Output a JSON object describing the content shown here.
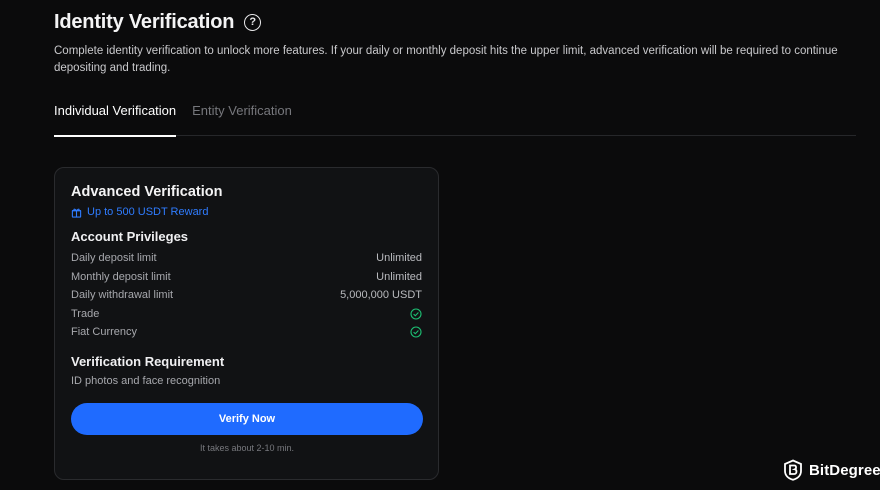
{
  "header": {
    "title": "Identity Verification",
    "subtitle": "Complete identity verification to unlock more features. If your daily or monthly deposit hits the upper limit, advanced verification will be required to continue depositing and trading."
  },
  "tabs": [
    {
      "label": "Individual Verification",
      "active": true
    },
    {
      "label": "Entity Verification",
      "active": false
    }
  ],
  "card": {
    "title": "Advanced Verification",
    "reward": "Up to 500 USDT Reward",
    "privileges_title": "Account Privileges",
    "privileges": [
      {
        "label": "Daily deposit limit",
        "value": "Unlimited"
      },
      {
        "label": "Monthly deposit limit",
        "value": "Unlimited"
      },
      {
        "label": "Daily withdrawal limit",
        "value": "5,000,000 USDT"
      },
      {
        "label": "Trade",
        "value": "check"
      },
      {
        "label": "Fiat Currency",
        "value": "check"
      }
    ],
    "requirement_title": "Verification Requirement",
    "requirement_text": "ID photos and face recognition",
    "button_label": "Verify Now",
    "hint": "It takes about 2-10 min."
  },
  "brand": {
    "name": "BitDegree"
  },
  "colors": {
    "accent": "#1f6bff",
    "reward": "#2f7cff",
    "check": "#1dbf73",
    "background": "#0b0b0c"
  }
}
